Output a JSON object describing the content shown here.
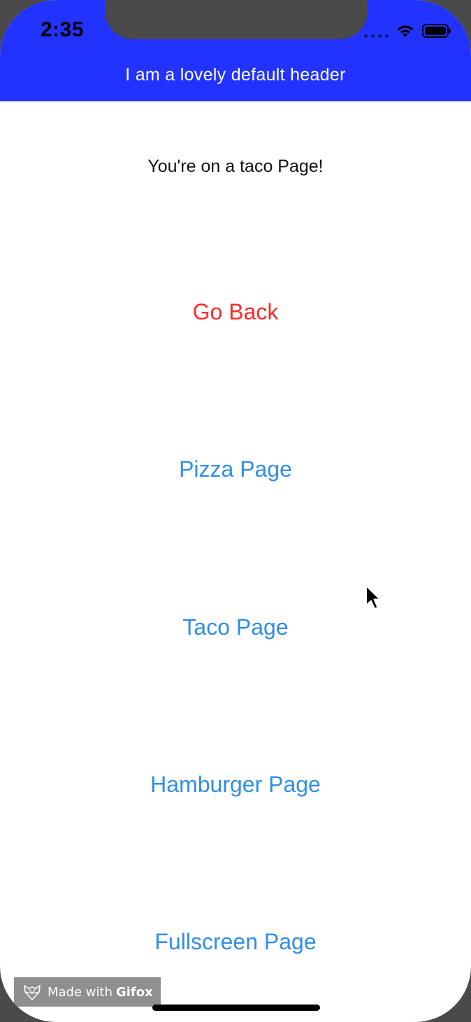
{
  "status_bar": {
    "time": "2:35",
    "icons": [
      "signal-dots-icon",
      "wifi-icon",
      "battery-icon"
    ]
  },
  "header": {
    "title": "I am a lovely default header",
    "background_color": "#2233ff"
  },
  "content": {
    "message": "You're on a taco Page!"
  },
  "buttons": {
    "go_back": "Go Back",
    "pizza": "Pizza Page",
    "taco": "Taco Page",
    "hamburger": "Hamburger Page",
    "fullscreen": "Fullscreen Page"
  },
  "colors": {
    "back_button": "#ff2b2b",
    "link_button": "#2f8ee8"
  },
  "watermark": {
    "prefix": "Made with",
    "brand": "Gifox"
  }
}
